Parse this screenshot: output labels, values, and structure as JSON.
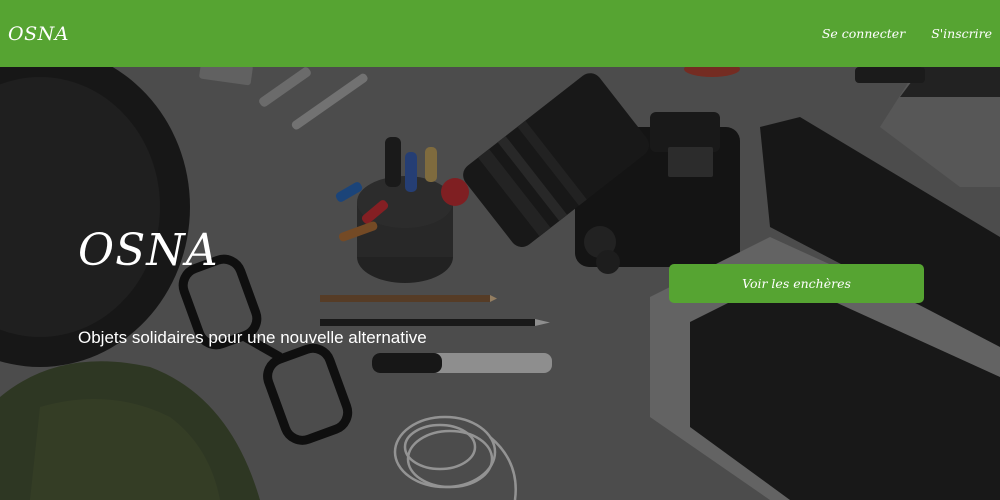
{
  "navbar": {
    "brand": "OSNA",
    "links": [
      {
        "label": "Se connecter"
      },
      {
        "label": "S'inscrire"
      }
    ]
  },
  "hero": {
    "title": "OSNA",
    "subtitle": "Objets solidaires pour une nouvelle alternative",
    "cta_label": "Voir les enchères"
  },
  "colors": {
    "brand_green": "#56a432",
    "text_on_dark": "#ffffff"
  }
}
